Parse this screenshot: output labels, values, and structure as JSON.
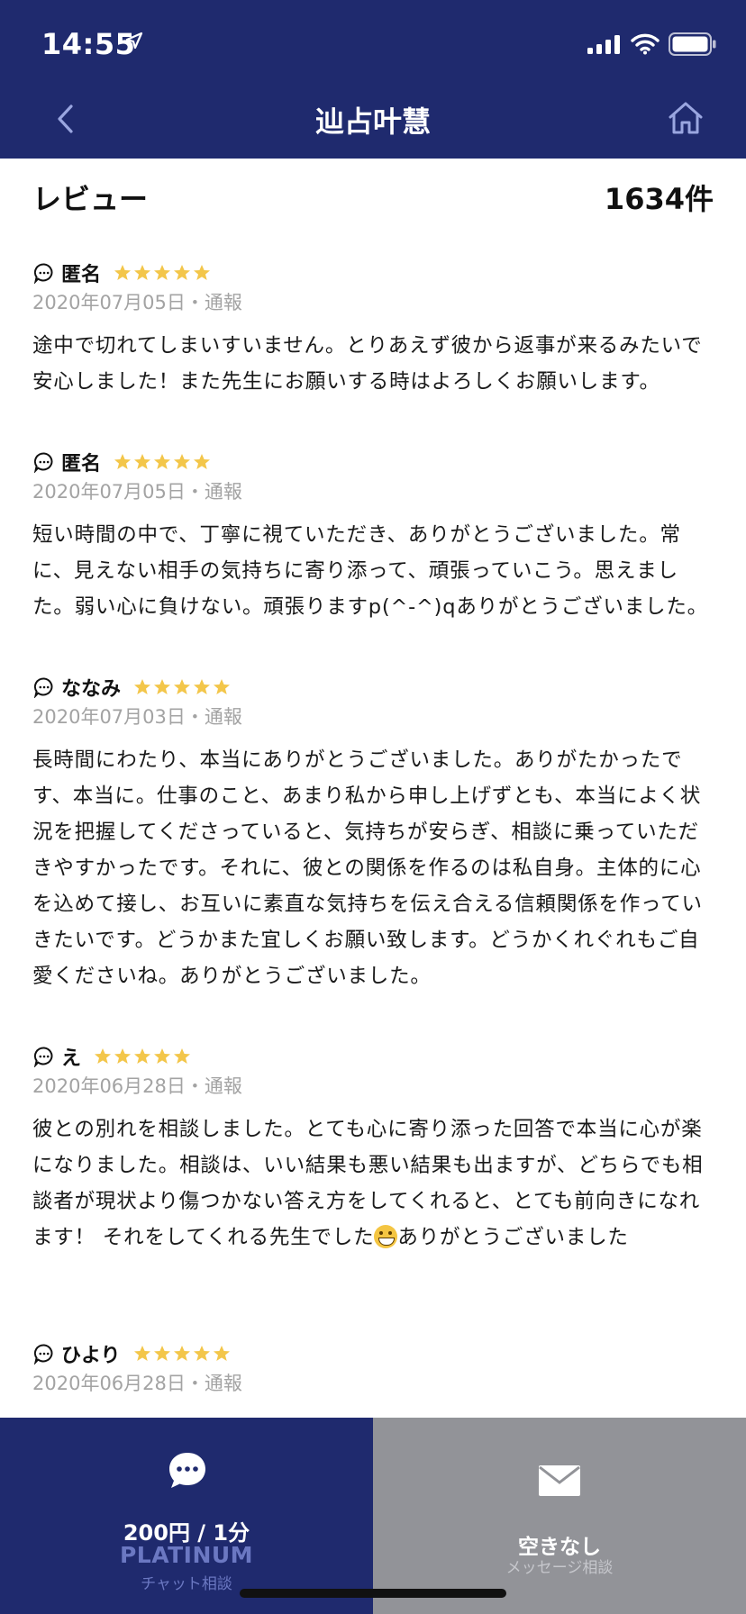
{
  "status_bar": {
    "time": "14:55",
    "location_icon": "location-arrow-icon",
    "signal_icon": "cellular-signal-icon",
    "wifi_icon": "wifi-icon",
    "battery_icon": "battery-icon"
  },
  "nav": {
    "title": "辿占叶慧",
    "back_icon": "chevron-left-icon",
    "home_icon": "home-icon"
  },
  "reviews_section": {
    "title": "レビュー",
    "count": "1634件"
  },
  "reviews": [
    {
      "name": "匿名",
      "rating": 5,
      "date": "2020年07月05日",
      "separator": "・",
      "report": "通報",
      "body": "途中で切れてしまいすいません。とりあえず彼から返事が来るみたいで安心しました！また先生にお願いする時はよろしくお願いします。"
    },
    {
      "name": "匿名",
      "rating": 5,
      "date": "2020年07月05日",
      "separator": "・",
      "report": "通報",
      "body": "短い時間の中で、丁寧に視ていただき、ありがとうございました。常に、見えない相手の気持ちに寄り添って、頑張っていこう。思えました。弱い心に負けない。頑張りますp(^-^)qありがとうございました。"
    },
    {
      "name": "ななみ",
      "rating": 5,
      "date": "2020年07月03日",
      "separator": "・",
      "report": "通報",
      "body": "長時間にわたり、本当にありがとうございました。ありがたかったです、本当に。仕事のこと、あまり私から申し上げずとも、本当によく状況を把握してくださっていると、気持ちが安らぎ、相談に乗っていただきやすかったです。それに、彼との関係を作るのは私自身。主体的に心を込めて接し、お互いに素直な気持ちを伝え合える信頼関係を作っていきたいです。どうかまた宜しくお願い致します。どうかくれぐれもご自愛くださいね。ありがとうございました。"
    },
    {
      "name": "え",
      "rating": 5,
      "date": "2020年06月28日",
      "separator": "・",
      "report": "通報",
      "body_before_emoji": "彼との別れを相談しました。とても心に寄り添った回答で本当に心が楽になりました。相談は、いい結果も悪い結果も出ますが、どちらでも相談者が現状より傷つかない答え方をしてくれると、とても前向きになれます！ それをしてくれる先生でした",
      "emoji": "grinning-face-emoji",
      "body_after_emoji": "ありがとうございました"
    },
    {
      "name": "ひより",
      "rating": 5,
      "date": "2020年06月28日",
      "separator": "・",
      "report": "通報"
    }
  ],
  "bottom_actions": {
    "chat": {
      "icon": "chat-bubble-icon",
      "price": "200円 / 1分",
      "tier": "PLATINUM",
      "label": "チャット相談"
    },
    "message": {
      "icon": "mail-icon",
      "status": "空きなし",
      "label": "メッセージ相談"
    }
  },
  "colors": {
    "header_bg": "#1f2a6e",
    "star": "#f3c64a",
    "meta_text": "#a3a3a3",
    "tier_text": "#6b78c2",
    "message_bg": "#929398"
  }
}
